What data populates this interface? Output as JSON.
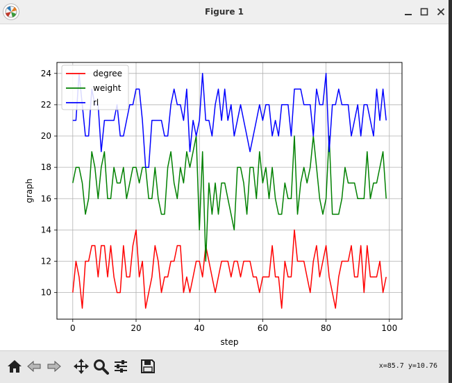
{
  "window": {
    "title": "Figure 1"
  },
  "toolbar": {
    "coords": "x=85.7 y=10.76"
  },
  "chart_data": {
    "type": "line",
    "xlabel": "step",
    "ylabel": "graph",
    "xlim": [
      -5,
      104
    ],
    "ylim": [
      8.3,
      24.7
    ],
    "xticks": [
      0,
      20,
      40,
      60,
      80,
      100
    ],
    "yticks": [
      10,
      12,
      14,
      16,
      18,
      20,
      22,
      24
    ],
    "grid": true,
    "legend_position": "upper left",
    "series": [
      {
        "name": "degree",
        "color": "#ff0000",
        "values": [
          10,
          12,
          11,
          9,
          12,
          12,
          13,
          13,
          11,
          13,
          13,
          11,
          13,
          11,
          10,
          10,
          13,
          11,
          11,
          13,
          14,
          11,
          12,
          9,
          10,
          11,
          13,
          12,
          10,
          11,
          11,
          12,
          12,
          13,
          13,
          10,
          11,
          10,
          11,
          12,
          12,
          11,
          13,
          12,
          11,
          10,
          11,
          12,
          12,
          12,
          11,
          12,
          12,
          11,
          12,
          12,
          12,
          11,
          11,
          10,
          11,
          11,
          11,
          13,
          11,
          11,
          9,
          12,
          11,
          11,
          14,
          12,
          12,
          12,
          11,
          10,
          12,
          13,
          11,
          12,
          13,
          11,
          10,
          9,
          11,
          12,
          12,
          12,
          13,
          11,
          11,
          13,
          10,
          13,
          11,
          11,
          11,
          12,
          10,
          11
        ]
      },
      {
        "name": "weight",
        "color": "#008000",
        "values": [
          17,
          18,
          18,
          17,
          15,
          16,
          19,
          18,
          16,
          18,
          19,
          16,
          16,
          18,
          17,
          17,
          18,
          16,
          17,
          18,
          18,
          17,
          18,
          18,
          16,
          16,
          18,
          16,
          15,
          15,
          18,
          19,
          17,
          16,
          18,
          17,
          19,
          18,
          19,
          20,
          14,
          19,
          12,
          17,
          15,
          17,
          15,
          17,
          17,
          16,
          15,
          14,
          18,
          18,
          17,
          15,
          18,
          18,
          16,
          19,
          17,
          18,
          16,
          18,
          16,
          15,
          15,
          17,
          16,
          16,
          20,
          15,
          17,
          18,
          17,
          18,
          20,
          18,
          16,
          15,
          16,
          20,
          15,
          15,
          15,
          16,
          18,
          17,
          17,
          17,
          16,
          16,
          16,
          19,
          16,
          17,
          17,
          18,
          19,
          16
        ]
      },
      {
        "name": "rl",
        "color": "#0000ff",
        "values": [
          21,
          21,
          24,
          22,
          20,
          20,
          23,
          22,
          22,
          19,
          21,
          21,
          21,
          21,
          22,
          20,
          20,
          21,
          22,
          22,
          23,
          23,
          21,
          18,
          18,
          21,
          21,
          21,
          21,
          20,
          20,
          22,
          23,
          22,
          22,
          21,
          23,
          19,
          21,
          20,
          21,
          24,
          21,
          21,
          20,
          22,
          23,
          21,
          23,
          21,
          22,
          20,
          21,
          22,
          21,
          20,
          19,
          20,
          21,
          22,
          21,
          22,
          22,
          20,
          21,
          20,
          22,
          22,
          22,
          20,
          23,
          23,
          23,
          22,
          22,
          22,
          20,
          23,
          22,
          22,
          24,
          19,
          22,
          22,
          23,
          22,
          22,
          22,
          20,
          21,
          22,
          20,
          22,
          22,
          21,
          20,
          23,
          21,
          23,
          21
        ]
      }
    ]
  }
}
